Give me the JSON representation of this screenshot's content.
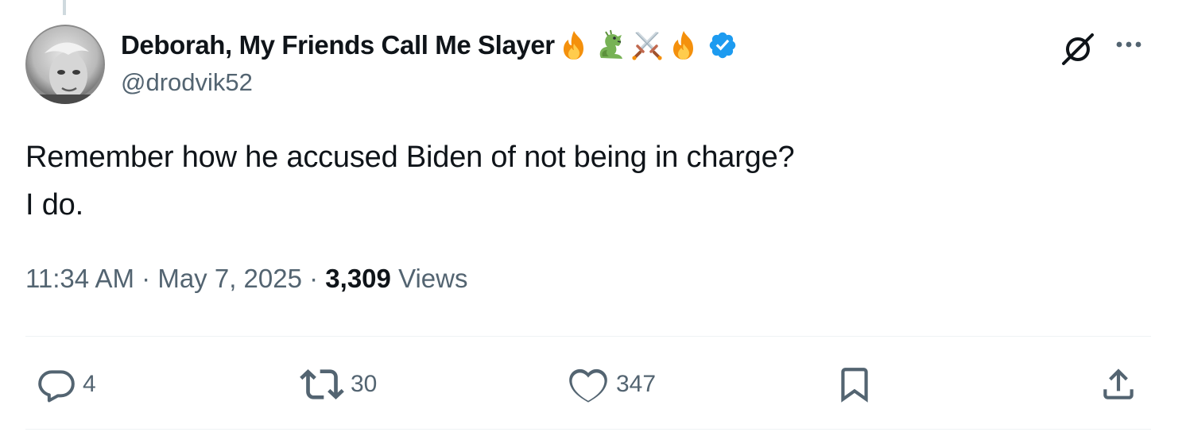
{
  "author": {
    "display_name": "Deborah, My Friends Call Me Slayer",
    "name_emojis": [
      "fire-emoji",
      "dragon-emoji",
      "crossed-swords-emoji",
      "fire-emoji"
    ],
    "handle": "@drodvik52",
    "verified": true
  },
  "tweet": {
    "text_line1": "Remember how he accused Biden of not being in charge?",
    "text_line2": "I do."
  },
  "meta": {
    "time": "11:34 AM",
    "separator": "·",
    "date": "May 7, 2025",
    "views_count": "3,309",
    "views_label": "Views"
  },
  "actions": {
    "replies": "4",
    "reposts": "30",
    "likes": "347"
  },
  "icons": {
    "reply": "reply-icon",
    "repost": "repost-icon",
    "like": "heart-icon",
    "bookmark": "bookmark-icon",
    "share": "share-icon",
    "grok": "grok-icon",
    "more": "more-icon",
    "verified": "verified-badge-icon"
  },
  "colors": {
    "text_primary": "#0f1419",
    "text_secondary": "#536471",
    "verified_blue": "#1d9bf0",
    "divider": "#eff3f4"
  }
}
